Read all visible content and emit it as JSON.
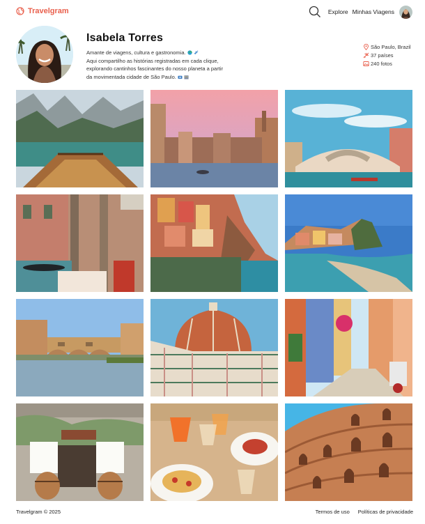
{
  "header": {
    "brand": "Travelgram",
    "nav": [
      "Explore",
      "Minhas Viagens"
    ],
    "accent": "#e9604d"
  },
  "profile": {
    "name": "Isabela Torres",
    "bio_line1": "Amante de viagens, cultura e gastronomia.",
    "bio_line2": "Aqui compartilho as histórias registradas em cada clique,",
    "bio_line3": "explorando cantinhos fascinantes do nosso planeta a partir",
    "bio_line4": "da movimentada cidade de São Paulo.",
    "location": "São Paulo, Brazil",
    "countries": "37 países",
    "photos": "240 fotos"
  },
  "gallery": [
    {
      "subject": "lake-boat"
    },
    {
      "subject": "venice-canal-sunset"
    },
    {
      "subject": "rialto-bridge"
    },
    {
      "subject": "venice-gondola-cafe"
    },
    {
      "subject": "manarola-cliffs"
    },
    {
      "subject": "cinque-terre-bay"
    },
    {
      "subject": "ponte-vecchio"
    },
    {
      "subject": "florence-duomo"
    },
    {
      "subject": "colorful-alley-scooter"
    },
    {
      "subject": "trattoria-barrels"
    },
    {
      "subject": "aperitivo-table"
    },
    {
      "subject": "colosseum"
    }
  ],
  "footer": {
    "copyright": "Travelgram © 2025",
    "terms": "Termos de uso",
    "privacy": "Políticas de privacidade"
  }
}
